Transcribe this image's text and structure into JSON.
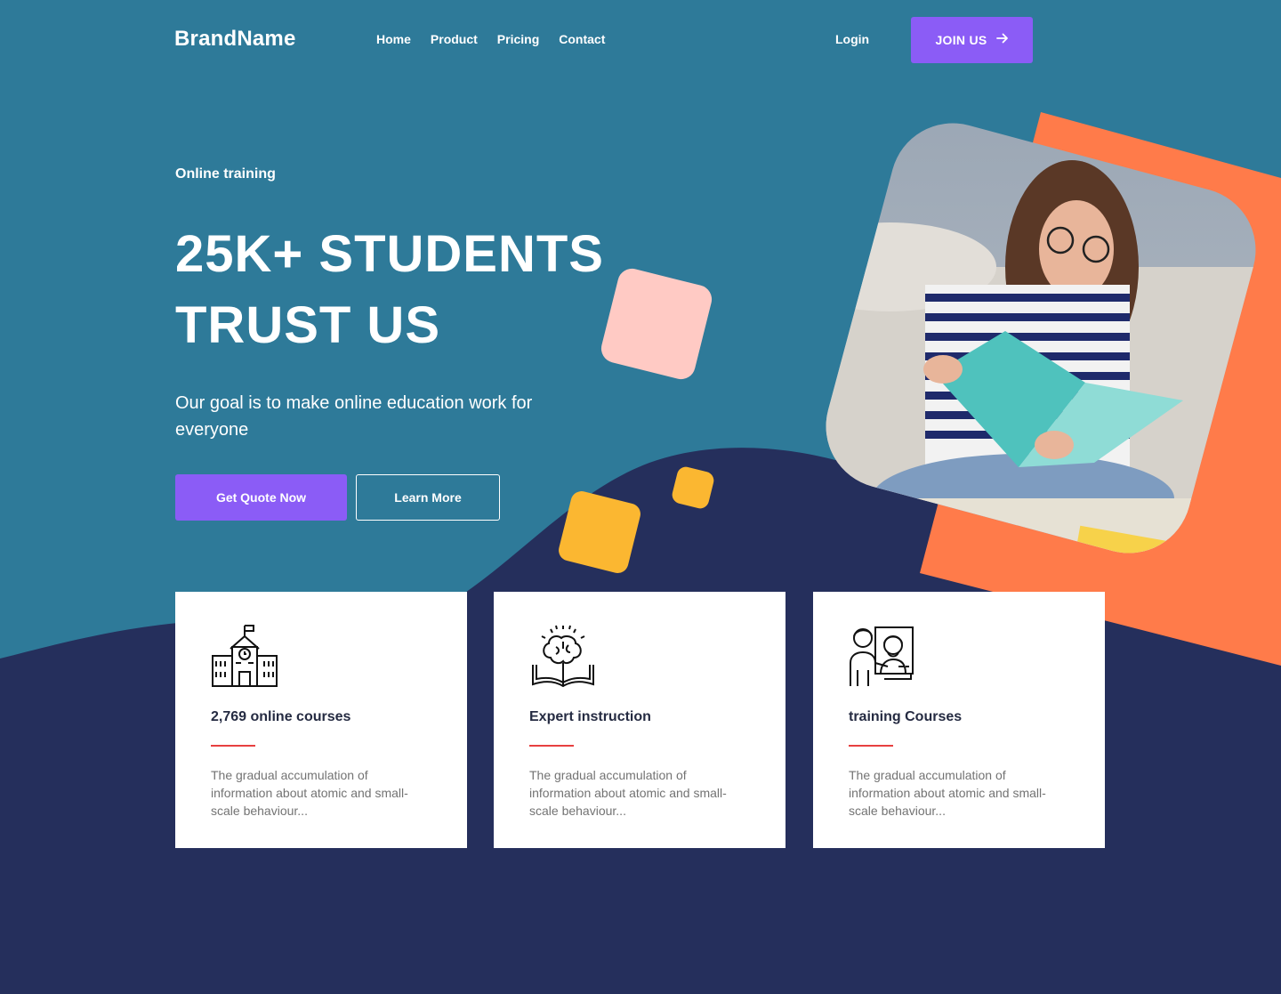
{
  "brand": "BrandName",
  "nav": {
    "links": [
      "Home",
      "Product",
      "Pricing",
      "Contact"
    ],
    "login": "Login",
    "join": "JOIN US"
  },
  "hero": {
    "eyebrow": "Online training",
    "headline_line1": "25K+ STUDENTS",
    "headline_line2": "TRUST US",
    "subtext": "Our goal is to make online education work for everyone",
    "primary_button": "Get Quote Now",
    "secondary_button": "Learn More",
    "image_icon": "student-reading-photo"
  },
  "cards": [
    {
      "icon": "school-building-icon",
      "title": "2,769 online courses",
      "desc": "The gradual accumulation of information about atomic and small-scale behaviour..."
    },
    {
      "icon": "brain-book-icon",
      "title": "Expert instruction",
      "desc": "The gradual accumulation of information about atomic and small-scale behaviour..."
    },
    {
      "icon": "teacher-screen-icon",
      "title": "training Courses",
      "desc": "The gradual accumulation of information about atomic and small-scale behaviour..."
    }
  ],
  "colors": {
    "hero_bg": "#2e7a99",
    "dark_bg": "#252f5c",
    "accent_purple": "#8b5cf6",
    "orange": "#ff7b4a",
    "pink": "#ffcac4",
    "yellow": "#fbb731",
    "divider_red": "#e74040"
  }
}
